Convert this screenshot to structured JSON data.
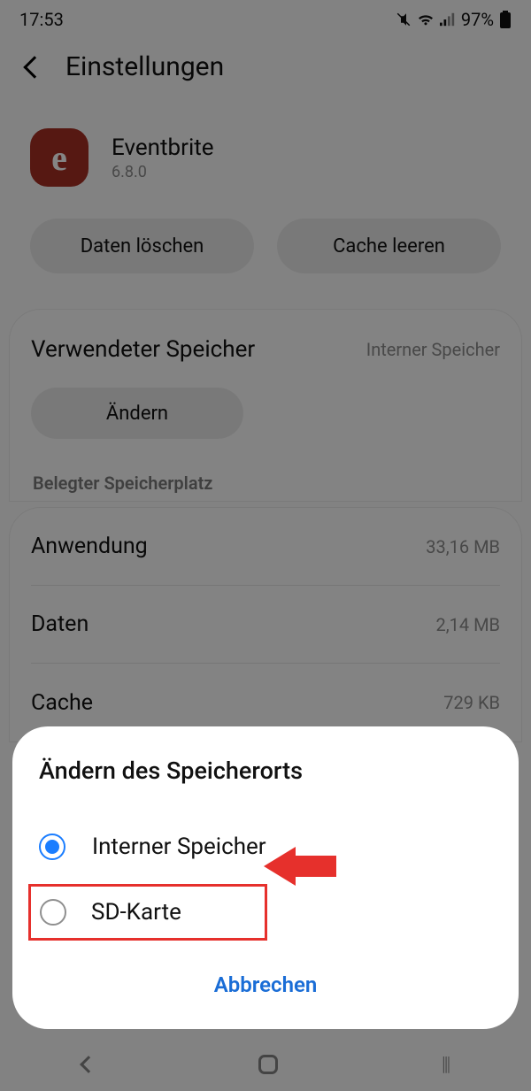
{
  "statusbar": {
    "time": "17:53",
    "battery": "97%"
  },
  "header": {
    "title": "Einstellungen"
  },
  "app": {
    "icon_letter": "e",
    "name": "Eventbrite",
    "version": "6.8.0"
  },
  "actions": {
    "clear_data": "Daten löschen",
    "clear_cache": "Cache leeren"
  },
  "storage": {
    "label": "Verwendeter Speicher",
    "value": "Interner Speicher",
    "change_button": "Ändern"
  },
  "usage": {
    "section_label": "Belegter Speicherplatz",
    "rows": [
      {
        "label": "Anwendung",
        "value": "33,16 MB"
      },
      {
        "label": "Daten",
        "value": "2,14 MB"
      },
      {
        "label": "Cache",
        "value": "729 KB"
      }
    ]
  },
  "dialog": {
    "title": "Ändern des Speicherorts",
    "options": [
      {
        "label": "Interner Speicher",
        "selected": true
      },
      {
        "label": "SD-Karte",
        "selected": false
      }
    ],
    "cancel": "Abbrechen"
  }
}
